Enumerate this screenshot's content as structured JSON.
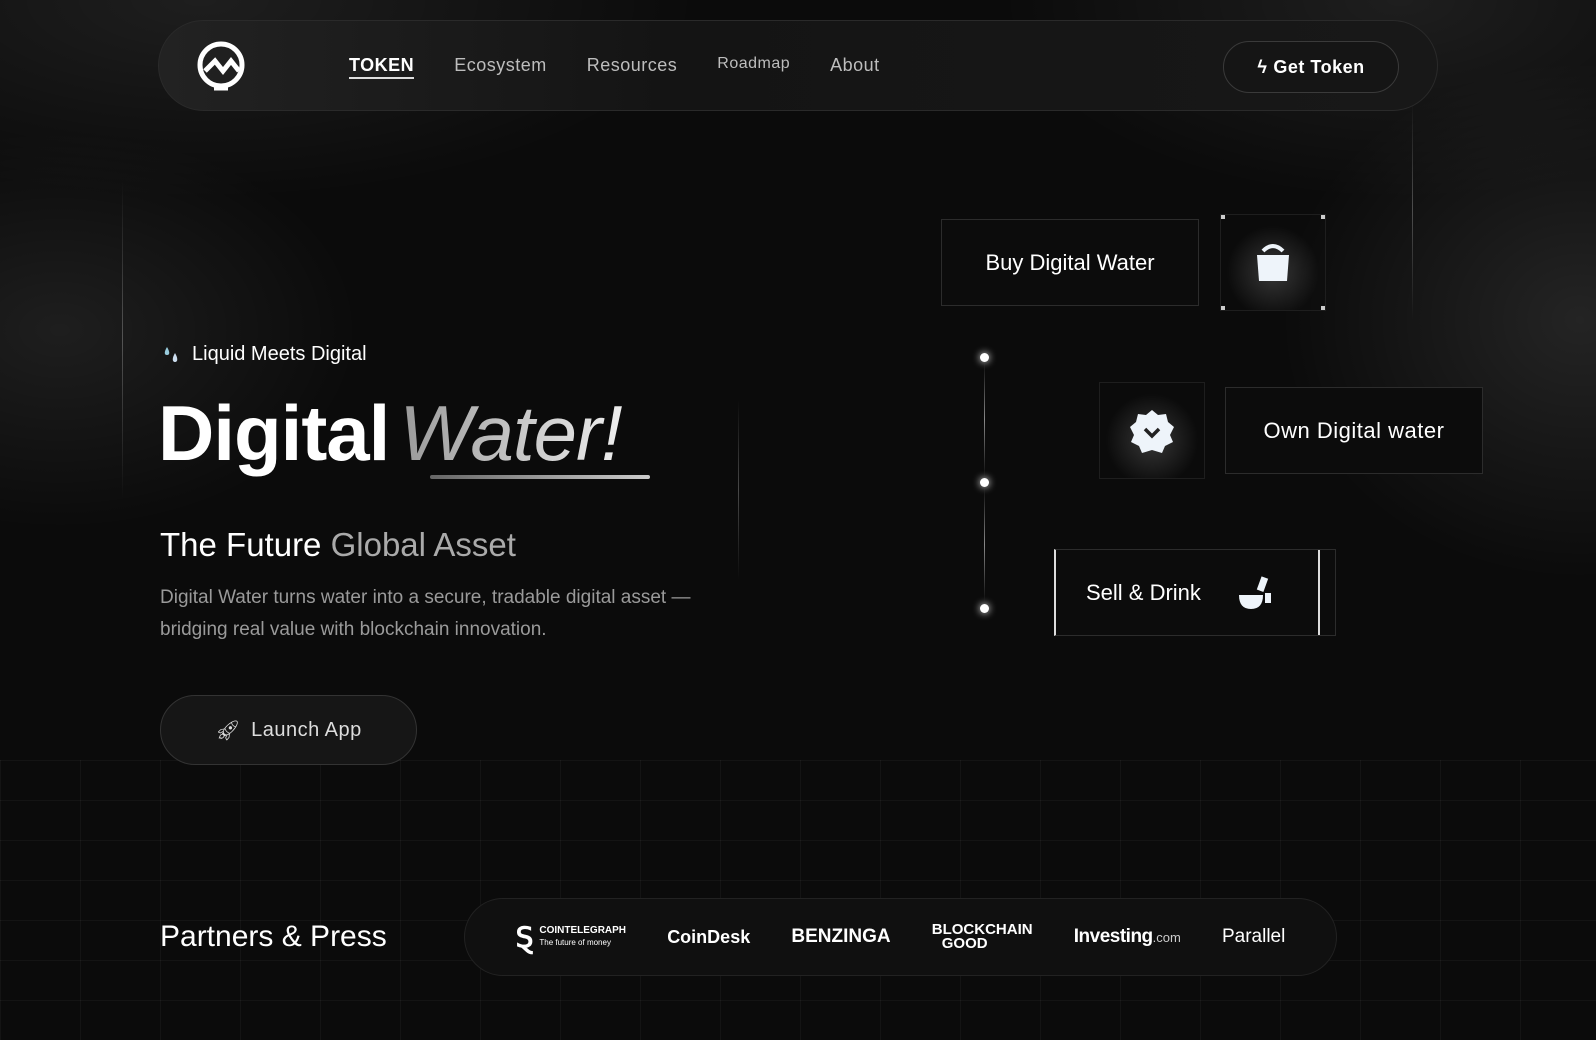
{
  "nav": {
    "links": [
      "TOKEN",
      "Ecosystem",
      "Resources",
      "Roadmap",
      "About"
    ],
    "cta": "Get Token"
  },
  "hero": {
    "tagline": "Liquid Meets Digital",
    "title_a": "Digital",
    "title_b": "Water!",
    "subtitle_a": "The Future",
    "subtitle_b": "Global Asset",
    "description": "Digital Water turns water into a secure, tradable digital asset — bridging real value with blockchain innovation.",
    "launch": "Launch App"
  },
  "flow": {
    "step1": "Buy Digital Water",
    "step2": "Own Digital water",
    "step3": "Sell & Drink"
  },
  "partners": {
    "title": "Partners & Press",
    "logos": [
      "COINTELEGRAPH",
      "The future of money",
      "CoinDesk",
      "BENZINGA",
      "BLOCKCHAIN",
      "GOOD",
      "Investing",
      ".com",
      "Parallel"
    ]
  }
}
